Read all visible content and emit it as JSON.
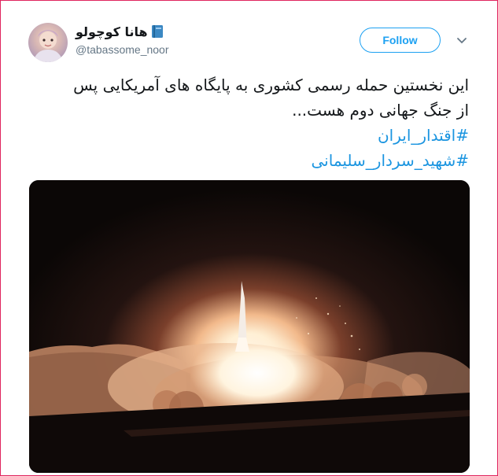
{
  "tweet": {
    "author": {
      "display_name": "هانا کوچولو",
      "handle": "@tabassome_noor",
      "name_emoji_icon": "book-icon"
    },
    "follow_label": "Follow",
    "text_lines": [
      "این نخستین حمله رسمی کشوری به پایگاه های آمریکایی پس",
      "از جنگ جهانی دوم هست..."
    ],
    "hashtags": [
      "#اقتدار_ایران",
      "#شهید_سردار_سلیمانی"
    ],
    "media": {
      "icon": "missile-launch-photo"
    }
  },
  "colors": {
    "accent": "#1da1f2",
    "hashtag": "#1b95e0",
    "text": "#14171a",
    "secondary": "#657786",
    "frame_border": "#e0245e"
  }
}
